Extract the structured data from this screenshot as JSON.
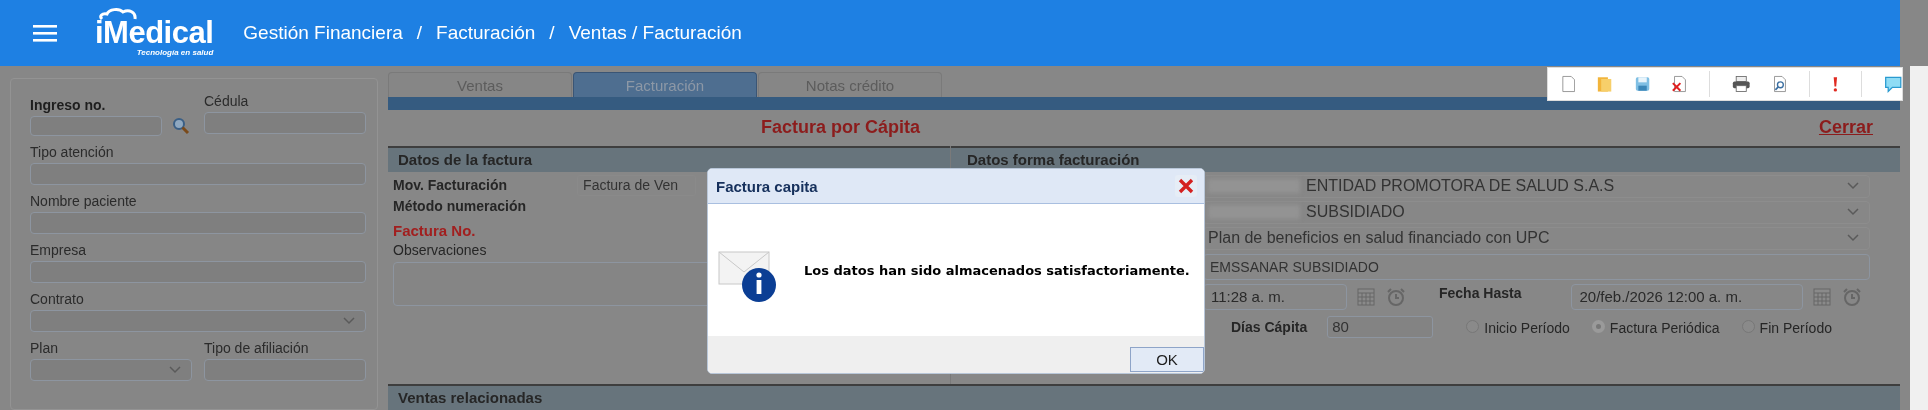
{
  "header": {
    "logo_name": "iMedical",
    "logo_tagline": "Tecnología en salud",
    "breadcrumb": [
      "Gestión Financiera",
      "Facturación",
      "Ventas / Facturación"
    ],
    "separator": "/"
  },
  "left_panel": {
    "rows": [
      [
        {
          "label": "Ingreso no.",
          "kind": "search",
          "bold": true
        },
        {
          "label": "Cédula",
          "kind": "input",
          "bold": false
        }
      ],
      [
        {
          "label": "Tipo atención",
          "kind": "input",
          "bold": false
        }
      ],
      [
        {
          "label": "Nombre paciente",
          "kind": "input",
          "bold": false
        }
      ],
      [
        {
          "label": "Empresa",
          "kind": "input",
          "bold": false
        }
      ],
      [
        {
          "label": "Contrato",
          "kind": "select",
          "bold": false
        }
      ],
      [
        {
          "label": "Plan",
          "kind": "select",
          "bold": false
        },
        {
          "label": "Tipo de afiliación",
          "kind": "input",
          "bold": false
        }
      ]
    ]
  },
  "tabs": [
    {
      "label": "Ventas",
      "selected": false
    },
    {
      "label": "Facturación",
      "selected": true
    },
    {
      "label": "Notas crédito",
      "selected": false
    }
  ],
  "title": "Factura por Cápita",
  "close_link": "Cerrar",
  "invoice_data": {
    "title": "Datos de la factura",
    "fields": [
      {
        "label": "Mov. Facturación",
        "kind": "select",
        "value": "Factura de Ven"
      },
      {
        "label": "Método numeración",
        "kind": "plain"
      },
      {
        "label": "Factura No.",
        "kind": "required"
      },
      {
        "label": "Observaciones",
        "kind": "textarea"
      }
    ]
  },
  "billing_form": {
    "title": "Datos forma facturación",
    "selects": [
      {
        "value": "ENTIDAD PROMOTORA DE SALUD S.A.S",
        "redacted": true
      },
      {
        "value": "SUBSIDIADO",
        "redacted": true
      },
      {
        "value": "Plan de beneficios en salud financiado con UPC",
        "redacted": false
      }
    ],
    "insurer": "EMSSANAR SUBSIDIADO",
    "from_value": "11:28 a. m.",
    "to_label": "Fecha Hasta",
    "to_value": "20/feb./2026 12:00 a. m.",
    "days_label": "Días Cápita",
    "days_value": "80",
    "radios": [
      {
        "label": "Inicio Período",
        "selected": false
      },
      {
        "label": "Factura Periódica",
        "selected": true
      },
      {
        "label": "Fin Período",
        "selected": false
      }
    ]
  },
  "related_sales": {
    "title": "Ventas relacionadas"
  },
  "dialog": {
    "title": "Factura capita",
    "message": "Los datos han sido almacenados satisfactoriamente.",
    "button": "OK"
  }
}
